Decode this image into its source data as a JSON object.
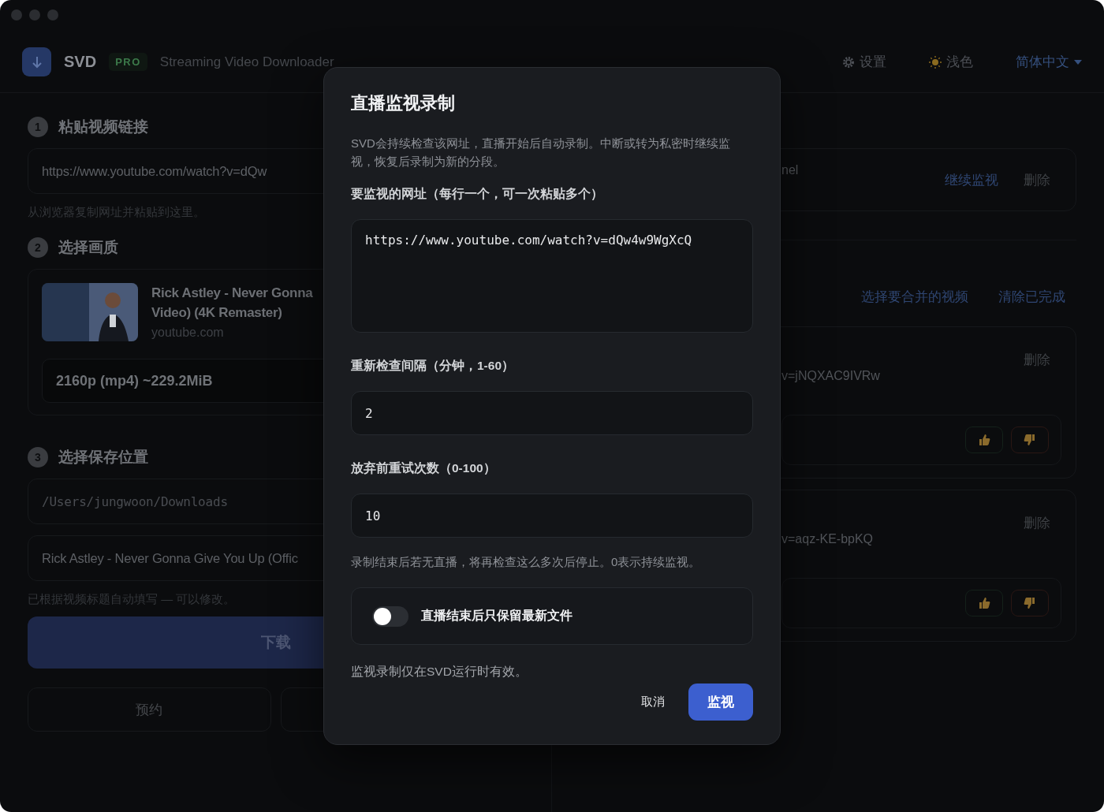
{
  "header": {
    "app_name": "SVD",
    "badge": "PRO",
    "subtitle": "Streaming Video Downloader",
    "actions": [
      {
        "kind": "settings",
        "label": "设置"
      },
      {
        "kind": "theme",
        "label": "浅色"
      },
      {
        "kind": "language",
        "label": "简体中文"
      }
    ]
  },
  "left": {
    "steps": [
      {
        "number": "1",
        "title": "粘贴视频链接"
      },
      {
        "number": "2",
        "title": "选择画质"
      },
      {
        "number": "3",
        "title": "选择保存位置"
      }
    ],
    "url_field": {
      "value": "https://www.youtube.com/watch?v=dQw"
    },
    "url_hint": "从浏览器复制网址并粘贴到这里。",
    "video": {
      "thumbnail": {
        "kind": "picture"
      },
      "title_lines": [
        "Rick Astley - Never Gonna",
        "Video) (4K Remaster)"
      ],
      "site": "youtube.com",
      "quality": "2160p (mp4) ~229.2MiB"
    },
    "folder_field": {
      "value": "/Users/jungwoon/Downloads"
    },
    "filename_field": {
      "value": "Rick Astley - Never Gonna Give You Up (Offic"
    },
    "filename_hint": "已根据视频标题自动填写 — 可以修改。",
    "download_button": "下载",
    "schedule_button": "预约"
  },
  "right": {
    "monitor_card": {
      "text": "nel",
      "resume": "继续监视",
      "delete": "删除"
    },
    "queue_actions": [
      "选择要合并的视频",
      "清除已完成"
    ],
    "downloads": [
      {
        "url": "v=jNQXAC9IVRw",
        "delete": "删除"
      },
      {
        "url": "v=aqz-KE-bpKQ",
        "delete": "删除"
      }
    ]
  },
  "dialog": {
    "title": "直播监视录制",
    "description": "SVD会持续检查该网址，直播开始后自动录制。中断或转为私密时继续监视，恢复后录制为新的分段。",
    "url_label": "要监视的网址（每行一个，可一次粘贴多个）",
    "url_value": "https://www.youtube.com/watch?v=dQw4w9WgXcQ",
    "interval_label": "重新检查间隔（分钟，1-60）",
    "interval_value": "2",
    "retries_label": "放弃前重试次数（0-100）",
    "retries_value": "10",
    "retries_hint": "录制结束后若无直播，将再检查这么多次后停止。0表示持续监视。",
    "keep_latest": {
      "label": "直播结束后只保留最新文件",
      "on": false
    },
    "note": "监视录制仅在SVD运行时有效。",
    "cancel": "取消",
    "confirm": "监视"
  }
}
